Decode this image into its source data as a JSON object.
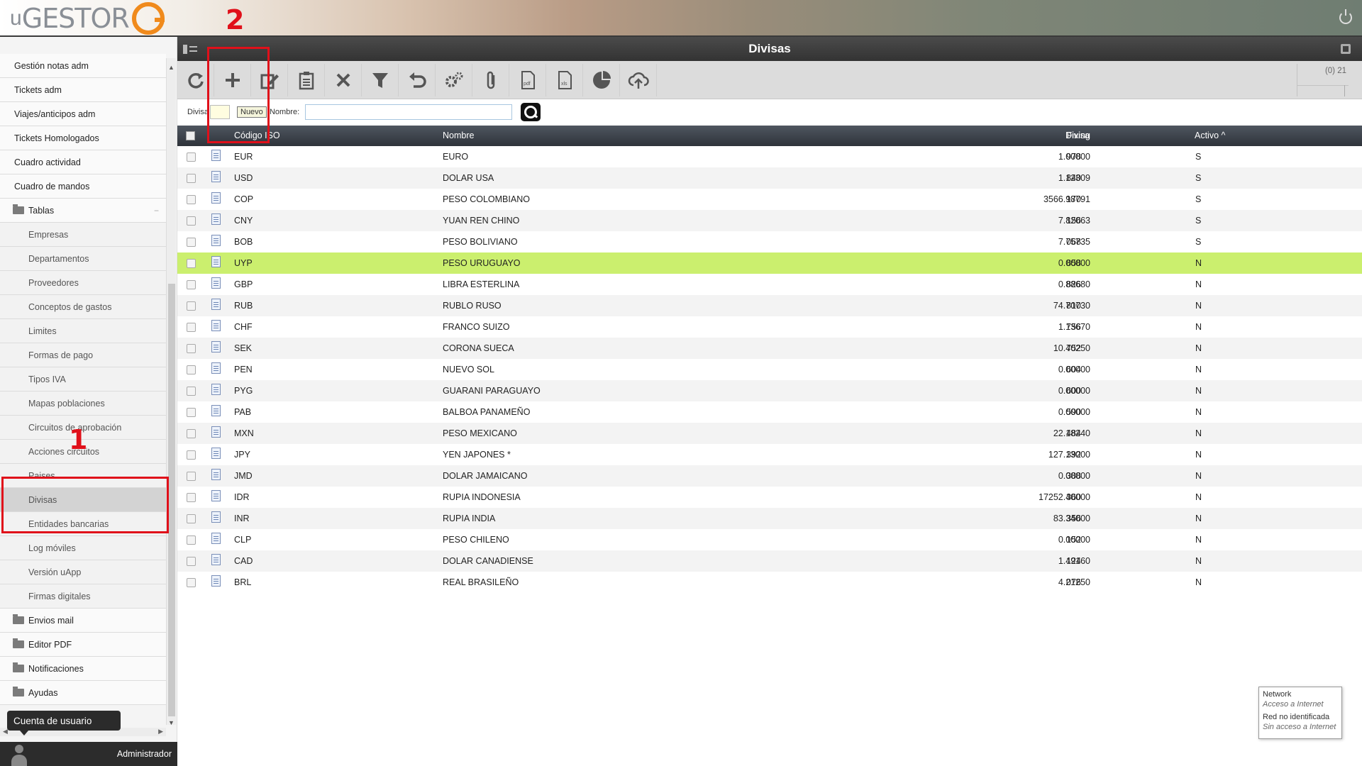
{
  "app": {
    "logo_text": "GESTOR",
    "logo_prefix": "u",
    "user": "Administrador",
    "user_tooltip": "Cuenta de usuario"
  },
  "page": {
    "title": "Divisas"
  },
  "sidebar": {
    "items": [
      {
        "label": "Gestión notas adm",
        "type": "item"
      },
      {
        "label": "Tickets adm",
        "type": "item"
      },
      {
        "label": "Viajes/anticipos adm",
        "type": "item"
      },
      {
        "label": "Tickets Homologados",
        "type": "item"
      },
      {
        "label": "Cuadro actividad",
        "type": "item"
      },
      {
        "label": "Cuadro de mandos",
        "type": "item"
      },
      {
        "label": "Tablas",
        "type": "folder",
        "collapse": "−"
      },
      {
        "label": "Empresas",
        "type": "sub"
      },
      {
        "label": "Departamentos",
        "type": "sub"
      },
      {
        "label": "Proveedores",
        "type": "sub"
      },
      {
        "label": "Conceptos de gastos",
        "type": "sub"
      },
      {
        "label": "Limites",
        "type": "sub"
      },
      {
        "label": "Formas de pago",
        "type": "sub"
      },
      {
        "label": "Tipos IVA",
        "type": "sub"
      },
      {
        "label": "Mapas poblaciones",
        "type": "sub"
      },
      {
        "label": "Circuitos de aprobación",
        "type": "sub"
      },
      {
        "label": "Acciones circuitos",
        "type": "sub"
      },
      {
        "label": "Paises",
        "type": "sub"
      },
      {
        "label": "Divisas",
        "type": "sub",
        "active": true
      },
      {
        "label": "Entidades bancarias",
        "type": "sub"
      },
      {
        "label": "Log móviles",
        "type": "sub"
      },
      {
        "label": "Versión uApp",
        "type": "sub"
      },
      {
        "label": "Firmas digitales",
        "type": "sub"
      },
      {
        "label": "Envios mail",
        "type": "folder"
      },
      {
        "label": "Editor PDF",
        "type": "folder"
      },
      {
        "label": "Notificaciones",
        "type": "folder"
      },
      {
        "label": "Ayudas",
        "type": "folder"
      }
    ]
  },
  "toolbar": {
    "buttons": [
      "refresh-icon",
      "add-icon",
      "edit-icon",
      "clipboard-icon",
      "delete-icon",
      "filter-icon",
      "undo-icon",
      "settings-icon",
      "attach-icon",
      "pdf-icon",
      "xls-icon",
      "chart-icon",
      "cloud-upload-icon"
    ],
    "pdf_text": "pdf",
    "xls_text": "xls",
    "count": "(0) 21"
  },
  "filter": {
    "divisa_label": "Divisa",
    "tooltip": "Nuevo",
    "name_label": "Nombre:",
    "name_value": ""
  },
  "table": {
    "headers": {
      "codigo": "Código ISO",
      "nombre": "Nombre",
      "fixing": "Fixing",
      "divisa": "Divisa",
      "activo": "Activo ^"
    },
    "rows": [
      {
        "code": "EUR",
        "name": "EURO",
        "fixing": "1.00000",
        "divisa": "978",
        "activo": "S"
      },
      {
        "code": "USD",
        "name": "DOLAR USA",
        "fixing": "1.12309",
        "divisa": "840",
        "activo": "S"
      },
      {
        "code": "COP",
        "name": "PESO COLOMBIANO",
        "fixing": "3566.98791",
        "divisa": "170",
        "activo": "S"
      },
      {
        "code": "CNY",
        "name": "YUAN REN CHINO",
        "fixing": "7.82063",
        "divisa": "156",
        "activo": "S"
      },
      {
        "code": "BOB",
        "name": "PESO BOLIVIANO",
        "fixing": "7.75735",
        "divisa": "068",
        "activo": "S"
      },
      {
        "code": "UYP",
        "name": "PESO URUGUAYO",
        "fixing": "0.00000",
        "divisa": "858",
        "activo": "N",
        "highlight": true
      },
      {
        "code": "GBP",
        "name": "LIBRA ESTERLINA",
        "fixing": "0.88680",
        "divisa": "826",
        "activo": "N"
      },
      {
        "code": "RUB",
        "name": "RUBLO RUSO",
        "fixing": "74.70730",
        "divisa": "810",
        "activo": "N"
      },
      {
        "code": "CHF",
        "name": "FRANCO SUIZO",
        "fixing": "1.13670",
        "divisa": "756",
        "activo": "N"
      },
      {
        "code": "SEK",
        "name": "CORONA SUECA",
        "fixing": "10.40250",
        "divisa": "752",
        "activo": "N"
      },
      {
        "code": "PEN",
        "name": "NUEVO SOL",
        "fixing": "0.00000",
        "divisa": "604",
        "activo": "N"
      },
      {
        "code": "PYG",
        "name": "GUARANI PARAGUAYO",
        "fixing": "0.00000",
        "divisa": "600",
        "activo": "N"
      },
      {
        "code": "PAB",
        "name": "BALBOA PANAMEÑO",
        "fixing": "0.00000",
        "divisa": "590",
        "activo": "N"
      },
      {
        "code": "MXN",
        "name": "PESO MEXICANO",
        "fixing": "22.18240",
        "divisa": "484",
        "activo": "N"
      },
      {
        "code": "JPY",
        "name": "YEN JAPONES *",
        "fixing": "127.13000",
        "divisa": "392",
        "activo": "N"
      },
      {
        "code": "JMD",
        "name": "DOLAR JAMAICANO",
        "fixing": "0.00000",
        "divisa": "388",
        "activo": "N"
      },
      {
        "code": "IDR",
        "name": "RUPIA INDONESIA",
        "fixing": "17252.40000",
        "divisa": "360",
        "activo": "N"
      },
      {
        "code": "INR",
        "name": "RUPIA INDIA",
        "fixing": "83.34000",
        "divisa": "356",
        "activo": "N"
      },
      {
        "code": "CLP",
        "name": "PESO CHILENO",
        "fixing": "0.00000",
        "divisa": "152",
        "activo": "N"
      },
      {
        "code": "CAD",
        "name": "DOLAR CANADIENSE",
        "fixing": "1.49160",
        "divisa": "124",
        "activo": "N"
      },
      {
        "code": "BRL",
        "name": "REAL BRASILEÑO",
        "fixing": "4.21250",
        "divisa": "076",
        "activo": "N"
      }
    ]
  },
  "annotations": {
    "one": "1",
    "two": "2",
    "color": "#e0101a"
  },
  "network_popup": {
    "line1": "Network",
    "line2": "Acceso a Internet",
    "line3": "Red no identificada",
    "line4": "Sin acceso a Internet"
  },
  "colors": {
    "highlight_row": "#cbef6e",
    "header_dark": "#333333",
    "accent_orange": "#f08a1c"
  }
}
